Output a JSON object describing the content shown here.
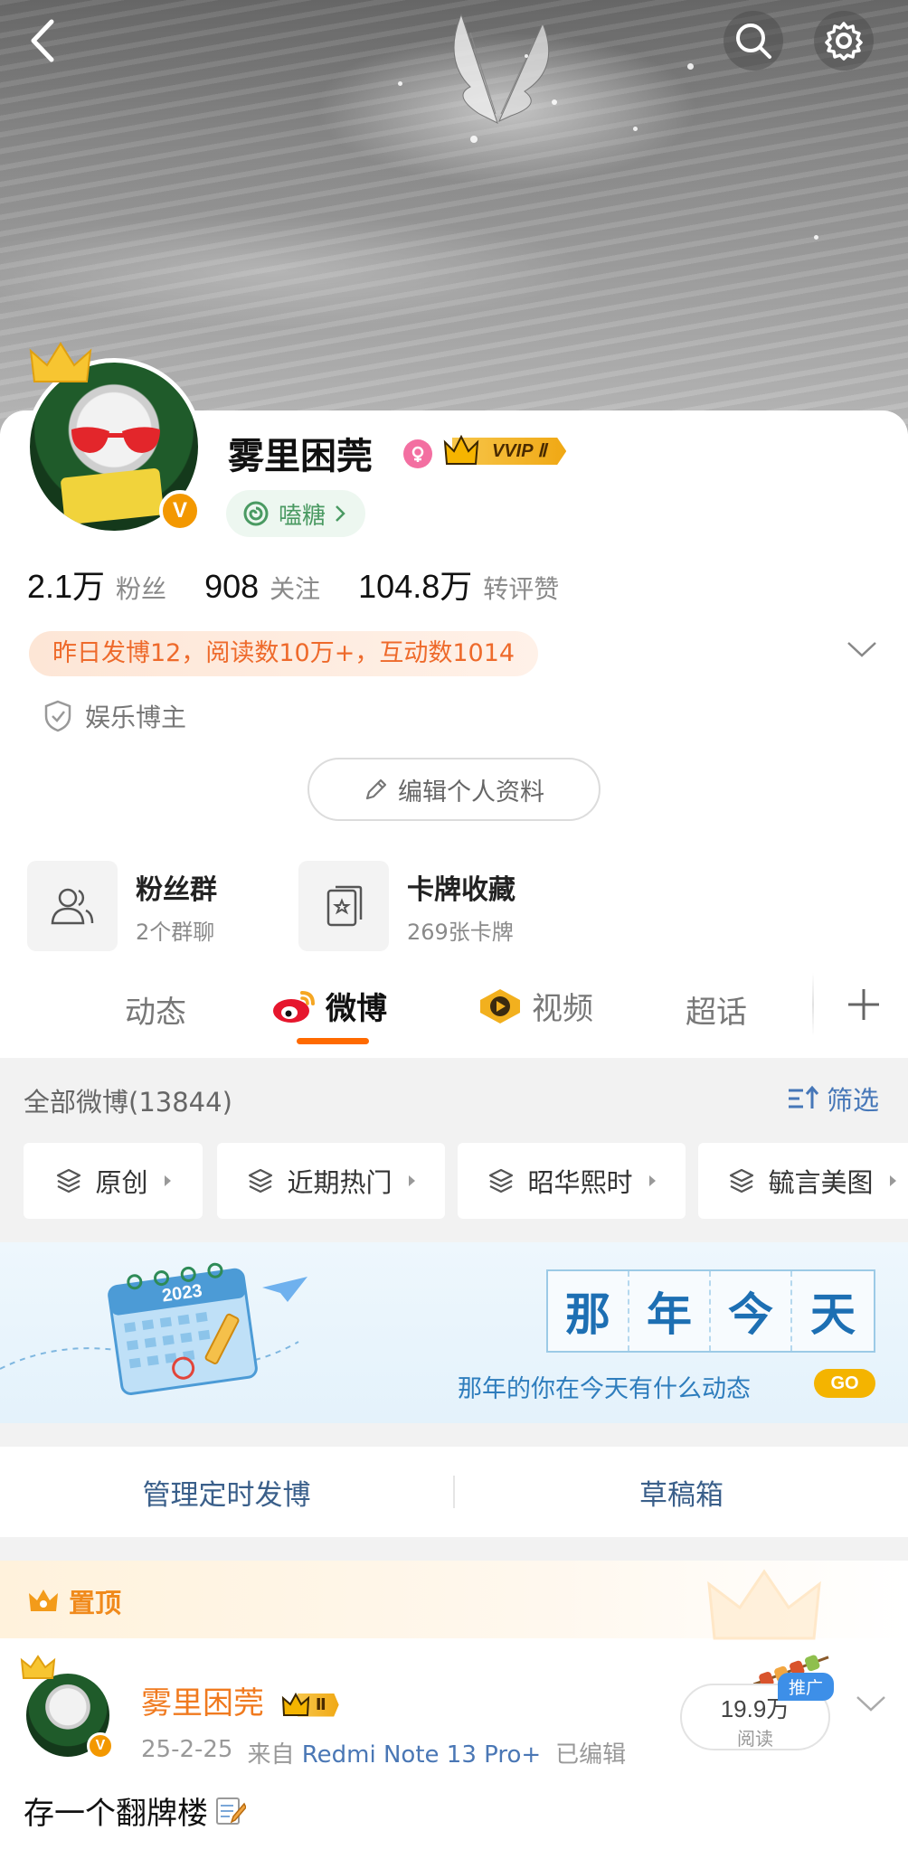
{
  "profile": {
    "name": "雾里困莞",
    "vip_badge": "VVIP",
    "vip_level": "Ⅱ",
    "candy_label": "嗑糖",
    "stats": [
      {
        "value": "2.1万",
        "label": "粉丝"
      },
      {
        "value": "908",
        "label": "关注"
      },
      {
        "value": "104.8万",
        "label": "转评赞"
      }
    ],
    "highlight": "昨日发博12，阅读数10万+，互动数1014",
    "role": "娱乐博主",
    "edit_label": "编辑个人资料",
    "verified_badge": "V"
  },
  "features": [
    {
      "title": "粉丝群",
      "subtitle": "2个群聊"
    },
    {
      "title": "卡牌收藏",
      "subtitle": "269张卡牌"
    }
  ],
  "tabs": [
    {
      "label": "动态"
    },
    {
      "label": "微博",
      "active": true
    },
    {
      "label": "视频"
    },
    {
      "label": "超话"
    }
  ],
  "feed": {
    "header": "全部微博(13844)",
    "filter_label": "筛选",
    "chips": [
      {
        "label": "原创"
      },
      {
        "label": "近期热门"
      },
      {
        "label": "昭华熙时"
      },
      {
        "label": "毓言美图"
      }
    ]
  },
  "banner": {
    "title_chars": [
      "那",
      "年",
      "今",
      "天"
    ],
    "tagline": "那年的你在今天有什么动态",
    "go_label": "GO",
    "calendar_year": "2023"
  },
  "manage": {
    "scheduled_label": "管理定时发博",
    "drafts_label": "草稿箱"
  },
  "pinned_post": {
    "pinned_label": "置顶",
    "author": "雾里困莞",
    "vip_level": "Ⅱ",
    "date": "25-2-25",
    "source_prefix": "来自",
    "device": "Redmi Note 13 Pro+",
    "edited": "已编辑",
    "reads_value": "19.9万",
    "reads_label": "阅读",
    "promo_tag": "推广",
    "text": "存一个翻牌楼"
  },
  "colors": {
    "accent_orange": "#ff6a00",
    "link_blue": "#4677b8",
    "vip_gold": "#f0a814",
    "highlight_text": "#ee6a2b"
  },
  "icons": [
    "back-icon",
    "search-icon",
    "gear-icon",
    "female-icon",
    "candy-icon",
    "chevron-down-icon",
    "shield-icon",
    "pencil-icon",
    "people-icon",
    "card-icon",
    "weibo-logo-icon",
    "video-icon",
    "plus-icon",
    "filter-icon",
    "layers-icon",
    "crown-icon",
    "memo-icon"
  ]
}
